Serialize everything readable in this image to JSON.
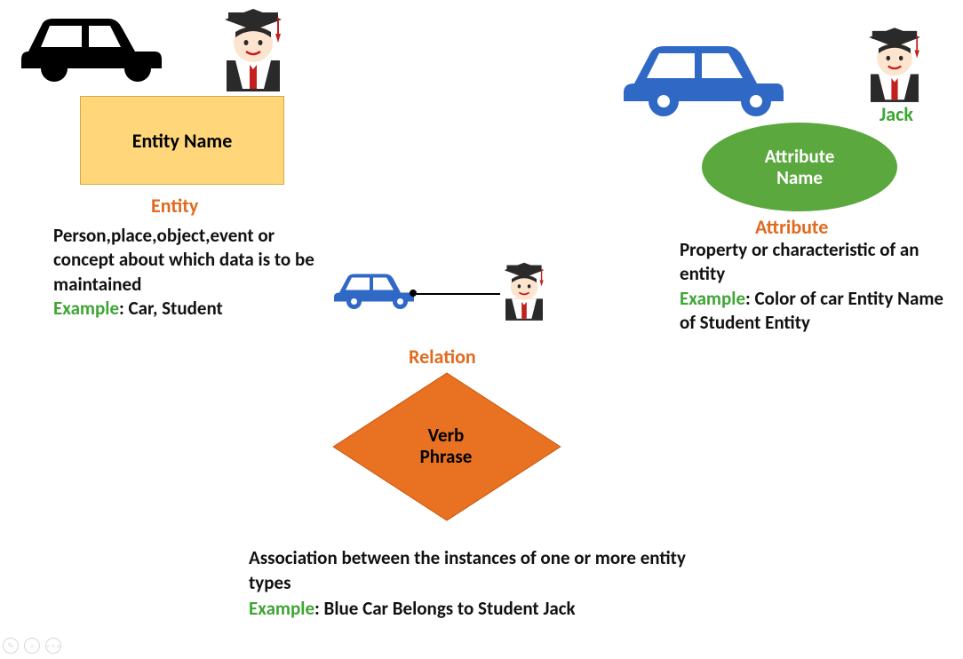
{
  "entity": {
    "box_label": "Entity Name",
    "title": "Entity",
    "description": "Person,place,object,event or concept about which data is to be maintained",
    "example_label": "Example",
    "example_text": ": Car, Student"
  },
  "attribute": {
    "ellipse_label_line1": "Attribute",
    "ellipse_label_line2": "Name",
    "instance_name": "Jack",
    "title": "Attribute",
    "description": "Property or characteristic of an entity",
    "example_label": "Example",
    "example_text": ": Color of car Entity Name of Student Entity"
  },
  "relation": {
    "title": "Relation",
    "diamond_label_line1": "Verb",
    "diamond_label_line2": "Phrase",
    "description": "Association between the instances of one or more entity types",
    "example_label": "Example",
    "example_text": ": Blue Car Belongs to Student Jack"
  },
  "icons": {
    "black_car": "black-car-icon",
    "blue_car": "blue-car-icon",
    "student": "student-graduate-icon"
  }
}
